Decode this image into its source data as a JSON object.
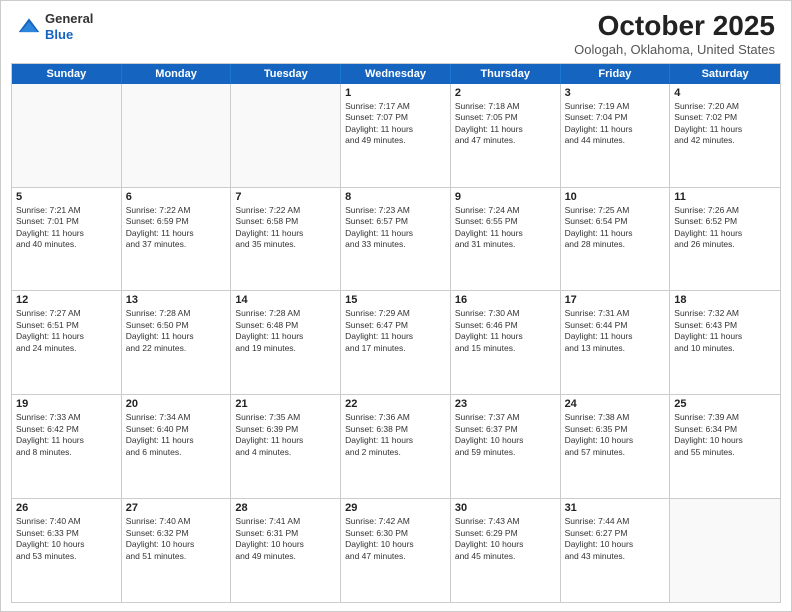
{
  "header": {
    "logo_general": "General",
    "logo_blue": "Blue",
    "month_title": "October 2025",
    "location": "Oologah, Oklahoma, United States"
  },
  "days_of_week": [
    "Sunday",
    "Monday",
    "Tuesday",
    "Wednesday",
    "Thursday",
    "Friday",
    "Saturday"
  ],
  "weeks": [
    [
      {
        "day": "",
        "info": ""
      },
      {
        "day": "",
        "info": ""
      },
      {
        "day": "",
        "info": ""
      },
      {
        "day": "1",
        "info": "Sunrise: 7:17 AM\nSunset: 7:07 PM\nDaylight: 11 hours\nand 49 minutes."
      },
      {
        "day": "2",
        "info": "Sunrise: 7:18 AM\nSunset: 7:05 PM\nDaylight: 11 hours\nand 47 minutes."
      },
      {
        "day": "3",
        "info": "Sunrise: 7:19 AM\nSunset: 7:04 PM\nDaylight: 11 hours\nand 44 minutes."
      },
      {
        "day": "4",
        "info": "Sunrise: 7:20 AM\nSunset: 7:02 PM\nDaylight: 11 hours\nand 42 minutes."
      }
    ],
    [
      {
        "day": "5",
        "info": "Sunrise: 7:21 AM\nSunset: 7:01 PM\nDaylight: 11 hours\nand 40 minutes."
      },
      {
        "day": "6",
        "info": "Sunrise: 7:22 AM\nSunset: 6:59 PM\nDaylight: 11 hours\nand 37 minutes."
      },
      {
        "day": "7",
        "info": "Sunrise: 7:22 AM\nSunset: 6:58 PM\nDaylight: 11 hours\nand 35 minutes."
      },
      {
        "day": "8",
        "info": "Sunrise: 7:23 AM\nSunset: 6:57 PM\nDaylight: 11 hours\nand 33 minutes."
      },
      {
        "day": "9",
        "info": "Sunrise: 7:24 AM\nSunset: 6:55 PM\nDaylight: 11 hours\nand 31 minutes."
      },
      {
        "day": "10",
        "info": "Sunrise: 7:25 AM\nSunset: 6:54 PM\nDaylight: 11 hours\nand 28 minutes."
      },
      {
        "day": "11",
        "info": "Sunrise: 7:26 AM\nSunset: 6:52 PM\nDaylight: 11 hours\nand 26 minutes."
      }
    ],
    [
      {
        "day": "12",
        "info": "Sunrise: 7:27 AM\nSunset: 6:51 PM\nDaylight: 11 hours\nand 24 minutes."
      },
      {
        "day": "13",
        "info": "Sunrise: 7:28 AM\nSunset: 6:50 PM\nDaylight: 11 hours\nand 22 minutes."
      },
      {
        "day": "14",
        "info": "Sunrise: 7:28 AM\nSunset: 6:48 PM\nDaylight: 11 hours\nand 19 minutes."
      },
      {
        "day": "15",
        "info": "Sunrise: 7:29 AM\nSunset: 6:47 PM\nDaylight: 11 hours\nand 17 minutes."
      },
      {
        "day": "16",
        "info": "Sunrise: 7:30 AM\nSunset: 6:46 PM\nDaylight: 11 hours\nand 15 minutes."
      },
      {
        "day": "17",
        "info": "Sunrise: 7:31 AM\nSunset: 6:44 PM\nDaylight: 11 hours\nand 13 minutes."
      },
      {
        "day": "18",
        "info": "Sunrise: 7:32 AM\nSunset: 6:43 PM\nDaylight: 11 hours\nand 10 minutes."
      }
    ],
    [
      {
        "day": "19",
        "info": "Sunrise: 7:33 AM\nSunset: 6:42 PM\nDaylight: 11 hours\nand 8 minutes."
      },
      {
        "day": "20",
        "info": "Sunrise: 7:34 AM\nSunset: 6:40 PM\nDaylight: 11 hours\nand 6 minutes."
      },
      {
        "day": "21",
        "info": "Sunrise: 7:35 AM\nSunset: 6:39 PM\nDaylight: 11 hours\nand 4 minutes."
      },
      {
        "day": "22",
        "info": "Sunrise: 7:36 AM\nSunset: 6:38 PM\nDaylight: 11 hours\nand 2 minutes."
      },
      {
        "day": "23",
        "info": "Sunrise: 7:37 AM\nSunset: 6:37 PM\nDaylight: 10 hours\nand 59 minutes."
      },
      {
        "day": "24",
        "info": "Sunrise: 7:38 AM\nSunset: 6:35 PM\nDaylight: 10 hours\nand 57 minutes."
      },
      {
        "day": "25",
        "info": "Sunrise: 7:39 AM\nSunset: 6:34 PM\nDaylight: 10 hours\nand 55 minutes."
      }
    ],
    [
      {
        "day": "26",
        "info": "Sunrise: 7:40 AM\nSunset: 6:33 PM\nDaylight: 10 hours\nand 53 minutes."
      },
      {
        "day": "27",
        "info": "Sunrise: 7:40 AM\nSunset: 6:32 PM\nDaylight: 10 hours\nand 51 minutes."
      },
      {
        "day": "28",
        "info": "Sunrise: 7:41 AM\nSunset: 6:31 PM\nDaylight: 10 hours\nand 49 minutes."
      },
      {
        "day": "29",
        "info": "Sunrise: 7:42 AM\nSunset: 6:30 PM\nDaylight: 10 hours\nand 47 minutes."
      },
      {
        "day": "30",
        "info": "Sunrise: 7:43 AM\nSunset: 6:29 PM\nDaylight: 10 hours\nand 45 minutes."
      },
      {
        "day": "31",
        "info": "Sunrise: 7:44 AM\nSunset: 6:27 PM\nDaylight: 10 hours\nand 43 minutes."
      },
      {
        "day": "",
        "info": ""
      }
    ]
  ]
}
